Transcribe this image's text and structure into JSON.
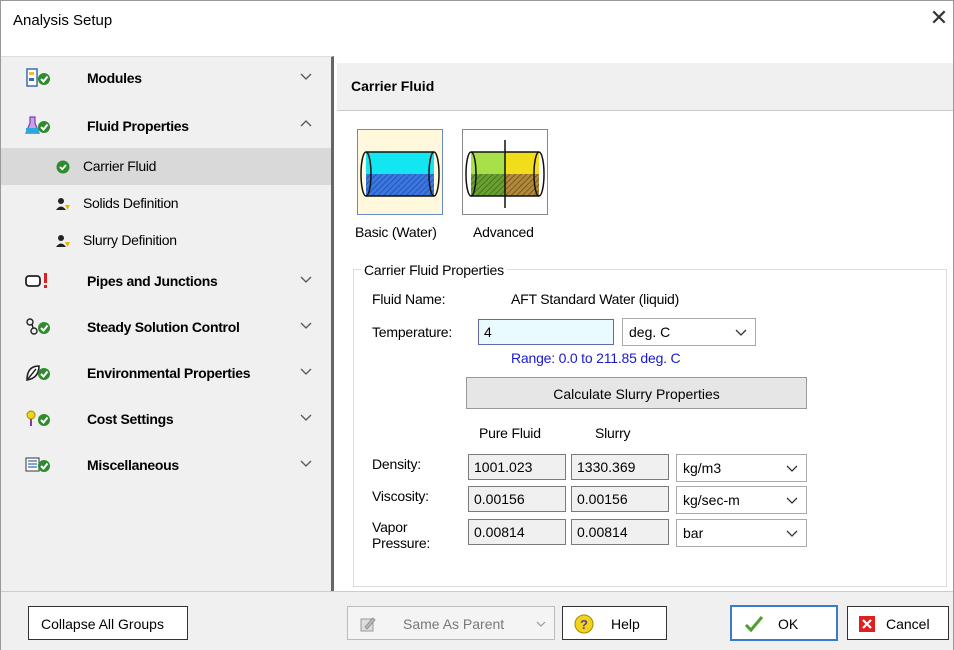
{
  "window": {
    "title": "Analysis Setup",
    "close_glyph": "✕"
  },
  "sidebar": {
    "groups": [
      {
        "label": "Modules",
        "icon": "modules-icon",
        "expanded": false
      },
      {
        "label": "Fluid Properties",
        "icon": "flask-icon",
        "expanded": true
      },
      {
        "label": "Pipes and Junctions",
        "icon": "pipe-icon",
        "expanded": false,
        "status": "error"
      },
      {
        "label": "Steady Solution Control",
        "icon": "solution-icon",
        "expanded": false
      },
      {
        "label": "Environmental Properties",
        "icon": "leaf-icon",
        "expanded": false
      },
      {
        "label": "Cost Settings",
        "icon": "cost-icon",
        "expanded": false
      },
      {
        "label": "Miscellaneous",
        "icon": "misc-icon",
        "expanded": false
      }
    ],
    "subitems": [
      {
        "label": "Carrier Fluid",
        "selected": true
      },
      {
        "label": "Solids Definition",
        "selected": false
      },
      {
        "label": "Slurry Definition",
        "selected": false
      }
    ]
  },
  "main": {
    "title": "Carrier Fluid",
    "fluid_options": [
      {
        "label": "Basic (Water)",
        "selected": true
      },
      {
        "label": "Advanced",
        "selected": false
      }
    ],
    "group_title": "Carrier Fluid Properties",
    "fluid_name_label": "Fluid Name:",
    "fluid_name_value": "AFT Standard Water (liquid)",
    "temperature_label": "Temperature:",
    "temperature_value": "4",
    "temperature_unit": "deg. C",
    "range_text": "Range: 0.0 to 211.85 deg. C",
    "calc_button": "Calculate Slurry Properties",
    "col_pure": "Pure Fluid",
    "col_slurry": "Slurry",
    "rows": [
      {
        "label": "Density:",
        "pure": "1001.023",
        "slurry": "1330.369",
        "unit": "kg/m3"
      },
      {
        "label": "Viscosity:",
        "pure": "0.00156",
        "slurry": "0.00156",
        "unit": "kg/sec-m"
      },
      {
        "label_line1": "Vapor",
        "label_line2": "Pressure:",
        "pure": "0.00814",
        "slurry": "0.00814",
        "unit": "bar"
      }
    ]
  },
  "bottom": {
    "collapse": "Collapse All Groups",
    "same_as_parent": "Same As Parent",
    "help": "Help",
    "ok": "OK",
    "cancel": "Cancel"
  },
  "colors": {
    "accent": "#3b7bd4",
    "range_text": "#1a1ad0",
    "check_green": "#2e8b2e",
    "error_red": "#e02020"
  }
}
